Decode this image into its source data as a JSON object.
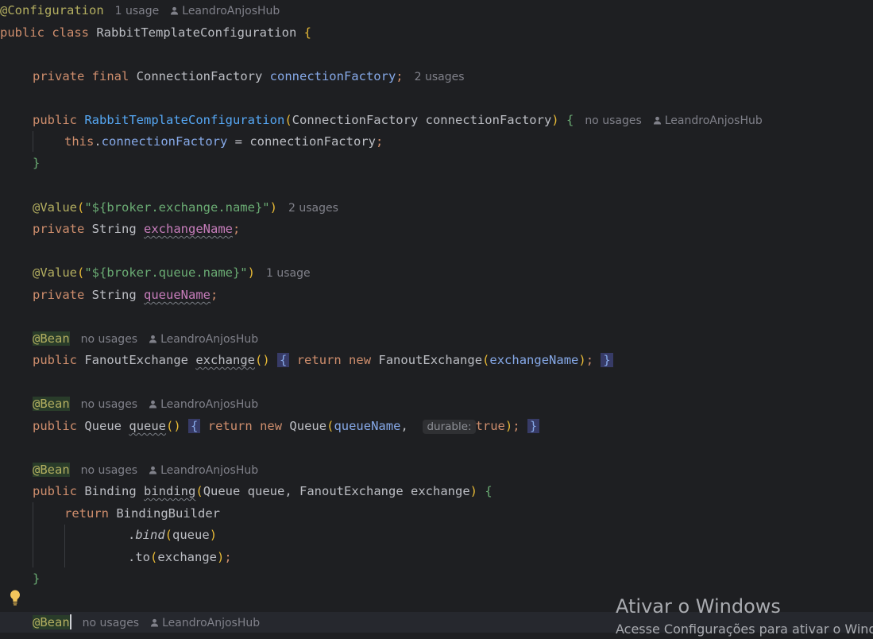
{
  "code": {
    "annotation_configuration": "@Configuration",
    "class_line_kw": "public class",
    "class_name": "RabbitTemplateConfiguration",
    "open_brace": "{",
    "field_kw": "private final",
    "field_type": "ConnectionFactory",
    "field_name": "connectionFactory",
    "ctor_kw": "public",
    "ctor_name": "RabbitTemplateConfiguration",
    "ctor_param_type": "ConnectionFactory",
    "ctor_param_name": "connectionFactory",
    "this_kw": "this",
    "assign_rhs": "connectionFactory",
    "value_ann": "@Value",
    "exchange_prop": "\"${broker.exchange.name}\"",
    "private_string": "private",
    "string_type": "String",
    "exchange_name_field": "exchangeName",
    "queue_prop": "\"${broker.queue.name}\"",
    "queue_name_field": "queueName",
    "bean_ann": "@Bean",
    "public_kw": "public",
    "fanout_type": "FanoutExchange",
    "exchange_method": "exchange",
    "return_kw": "return",
    "new_kw": "new",
    "queue_type": "Queue",
    "queue_method": "queue",
    "durable_hint": "durable:",
    "true_kw": "true",
    "binding_type": "Binding",
    "binding_method": "binding",
    "binding_params_queue": "Queue queue",
    "binding_params_exchange": "FanoutExchange exchange",
    "binding_builder": "BindingBuilder",
    "bind_call": "bind",
    "bind_arg": "queue",
    "to_call": "to",
    "to_arg": "exchange"
  },
  "hints": {
    "one_usage": "1 usage",
    "two_usages": "2 usages",
    "no_usages": "no usages",
    "author": "LeandroAnjosHub"
  },
  "watermark": {
    "title": "Ativar o Windows",
    "subtitle": "Acesse Configurações para ativar o Wind"
  },
  "colors": {
    "background": "#1e1f22",
    "keyword": "#cf8e6d",
    "annotation": "#b3ae60",
    "string": "#6aab73",
    "field": "#c77dbb"
  }
}
